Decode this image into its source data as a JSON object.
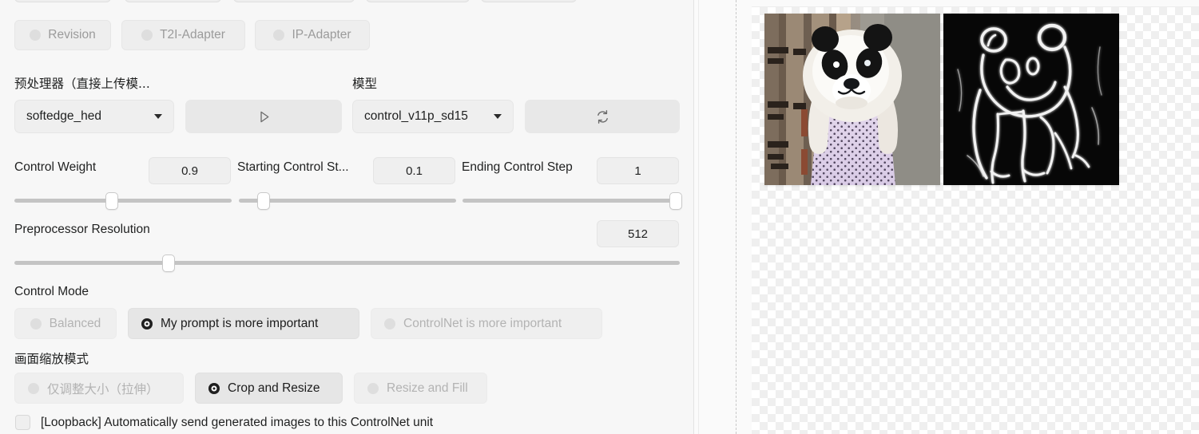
{
  "left_panel": {
    "cut_off_buttons_row1": [
      {
        "name": "partial-button-1"
      },
      {
        "name": "partial-button-2"
      },
      {
        "name": "partial-button-3"
      },
      {
        "name": "partial-button-4"
      },
      {
        "name": "partial-button-5"
      }
    ],
    "module_toggles": [
      {
        "label": "Revision",
        "selected": false
      },
      {
        "label": "T2I-Adapter",
        "selected": false
      },
      {
        "label": "IP-Adapter",
        "selected": false
      }
    ],
    "preprocessor": {
      "label": "预处理器（直接上传模...",
      "value": "softedge_hed",
      "run_icon": "play-icon"
    },
    "model": {
      "label": "模型",
      "value": "control_v11p_sd15",
      "refresh_icon": "refresh-icon"
    },
    "sliders": [
      {
        "label": "Control Weight",
        "value": "0.9",
        "fill": 0.45
      },
      {
        "label": "Starting Control St...",
        "value": "0.1",
        "fill": 0.1
      },
      {
        "label": "Ending Control Step",
        "value": "1",
        "fill": 1.0
      }
    ],
    "preprocessor_resolution": {
      "label": "Preprocessor Resolution",
      "value": "512",
      "fill": 0.232
    },
    "control_mode": {
      "label": "Control Mode",
      "options": [
        {
          "label": "Balanced",
          "selected": false
        },
        {
          "label": "My prompt is more important",
          "selected": true
        },
        {
          "label": "ControlNet is more important",
          "selected": false
        }
      ]
    },
    "resize_mode": {
      "label": "画面缩放模式",
      "options": [
        {
          "label": "仅调整大小（拉伸）",
          "selected": false
        },
        {
          "label": "Crop and Resize",
          "selected": true
        },
        {
          "label": "Resize and Fill",
          "selected": false
        }
      ]
    },
    "loopback": {
      "label": "[Loopback] Automatically send generated images to this ControlNet unit",
      "checked": false
    }
  },
  "right_panel": {
    "images": [
      {
        "name": "source-photo",
        "alt": "panda mascot costume standing by wooden wall"
      },
      {
        "name": "softedge-preview",
        "alt": "white soft edge outline of panda on black background"
      }
    ]
  },
  "colors": {
    "panel_bg": "#f7f7f7",
    "control_bg": "#efefef",
    "selected_bg": "#e6e6e6",
    "text": "#1f2020",
    "muted_text": "#b3b3b3",
    "track": "#c4c4c4"
  }
}
